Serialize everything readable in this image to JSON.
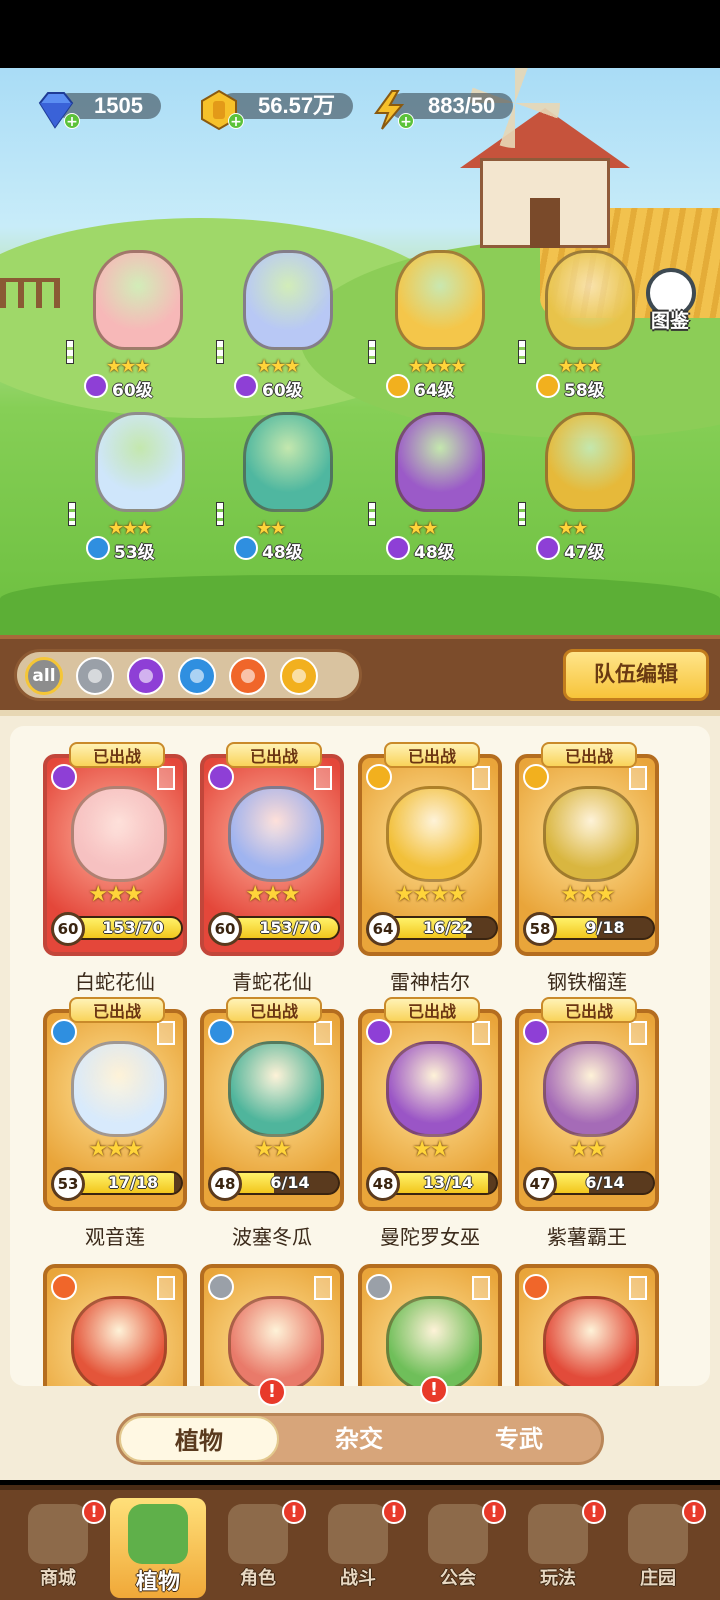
{
  "currencies": {
    "diamond": {
      "icon": "diamond-icon",
      "value": "1505"
    },
    "gold": {
      "icon": "gold-coin-icon",
      "value": "56.57万"
    },
    "energy": {
      "icon": "lightning-icon",
      "value": "883/50"
    }
  },
  "atlas": {
    "label": "图鉴"
  },
  "formation": [
    {
      "level": "60级",
      "stars": 3,
      "element": "poison",
      "color": "#f7b8b8"
    },
    {
      "level": "60级",
      "stars": 3,
      "element": "poison",
      "color": "#b8c8f5"
    },
    {
      "level": "64级",
      "stars": 4,
      "element": "lightning",
      "color": "#f4c64a"
    },
    {
      "level": "58级",
      "stars": 3,
      "element": "lightning",
      "color": "#e8c34a"
    },
    {
      "level": "53级",
      "stars": 3,
      "element": "water",
      "color": "#cfe6fb"
    },
    {
      "level": "48级",
      "stars": 2,
      "element": "water",
      "color": "#4fb7a0"
    },
    {
      "level": "48级",
      "stars": 2,
      "element": "poison",
      "color": "#9b5ac8"
    },
    {
      "level": "47级",
      "stars": 2,
      "element": "poison",
      "color": "#e6b93a"
    }
  ],
  "filters": [
    {
      "name": "all",
      "label": "all"
    },
    {
      "name": "sword"
    },
    {
      "name": "poison"
    },
    {
      "name": "water"
    },
    {
      "name": "fire"
    },
    {
      "name": "lightning"
    }
  ],
  "team_edit": "队伍编辑",
  "deployed_label": "已出战",
  "cards": [
    {
      "name": "白蛇花仙",
      "level": "60",
      "progress": "153/70",
      "fill": 1.0,
      "stars": 3,
      "element": "poison",
      "style": "red",
      "color": "#f6c1c1"
    },
    {
      "name": "青蛇花仙",
      "level": "60",
      "progress": "153/70",
      "fill": 1.0,
      "stars": 3,
      "element": "poison",
      "style": "red",
      "color": "#9fb4f0"
    },
    {
      "name": "雷神桔尔",
      "level": "64",
      "progress": "16/22",
      "fill": 0.73,
      "stars": 4,
      "element": "lightning",
      "style": "gold",
      "color": "#f2c03a"
    },
    {
      "name": "钢铁榴莲",
      "level": "58",
      "progress": "9/18",
      "fill": 0.5,
      "stars": 3,
      "element": "lightning",
      "style": "gold",
      "color": "#d9b640"
    },
    {
      "name": "观音莲",
      "level": "53",
      "progress": "17/18",
      "fill": 0.94,
      "stars": 3,
      "element": "water",
      "style": "gold",
      "color": "#d8eafc"
    },
    {
      "name": "波塞冬瓜",
      "level": "48",
      "progress": "6/14",
      "fill": 0.43,
      "stars": 2,
      "element": "water",
      "style": "gold",
      "color": "#4fb59c"
    },
    {
      "name": "曼陀罗女巫",
      "level": "48",
      "progress": "13/14",
      "fill": 0.93,
      "stars": 2,
      "element": "poison",
      "style": "gold",
      "color": "#9a55c6"
    },
    {
      "name": "紫薯霸王",
      "level": "47",
      "progress": "6/14",
      "fill": 0.43,
      "stars": 2,
      "element": "poison",
      "style": "gold",
      "color": "#a56bb7"
    },
    {
      "name": "",
      "element": "fire",
      "style": "gold",
      "color": "#e4553a"
    },
    {
      "name": "",
      "element": "sword",
      "style": "gold",
      "color": "#e97a6a"
    },
    {
      "name": "",
      "element": "sword",
      "style": "gold",
      "color": "#6fbf5a"
    },
    {
      "name": "",
      "element": "fire",
      "style": "gold",
      "color": "#e24b3a"
    }
  ],
  "subtabs": {
    "plants": "植物",
    "hybrid": "杂交",
    "exclusive": "专武"
  },
  "nav": [
    {
      "label": "商城",
      "icon": "shop-icon"
    },
    {
      "label": "植物",
      "icon": "plant-icon",
      "active": true
    },
    {
      "label": "角色",
      "icon": "character-icon"
    },
    {
      "label": "战斗",
      "icon": "battle-icon"
    },
    {
      "label": "公会",
      "icon": "guild-icon"
    },
    {
      "label": "玩法",
      "icon": "gameplay-icon"
    },
    {
      "label": "庄园",
      "icon": "manor-icon"
    }
  ],
  "element_colors": {
    "poison": "#8e3fd6",
    "water": "#2f8fe0",
    "lightning": "#f2b01e",
    "fire": "#f0662a",
    "sword": "#9aa0a8",
    "all": "#7a7a7a"
  }
}
